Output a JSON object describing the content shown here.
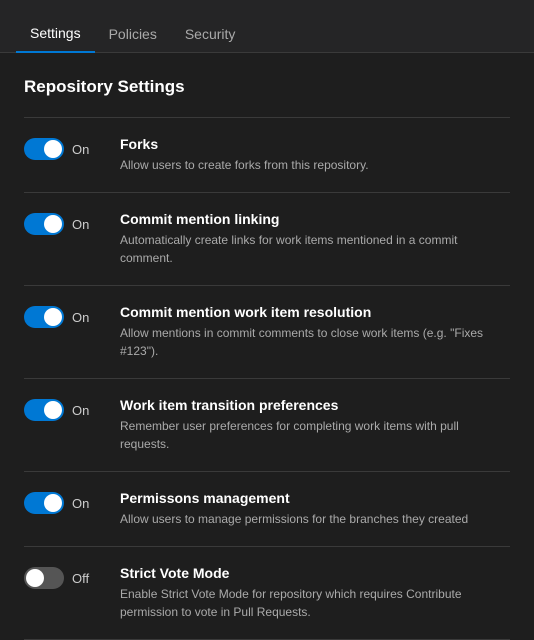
{
  "tabs": [
    {
      "id": "settings",
      "label": "Settings",
      "active": true
    },
    {
      "id": "policies",
      "label": "Policies",
      "active": false
    },
    {
      "id": "security",
      "label": "Security",
      "active": false
    }
  ],
  "section": {
    "title": "Repository Settings"
  },
  "settings": [
    {
      "id": "forks",
      "state": "on",
      "stateLabel": "On",
      "name": "Forks",
      "description": "Allow users to create forks from this repository."
    },
    {
      "id": "commit-mention-linking",
      "state": "on",
      "stateLabel": "On",
      "name": "Commit mention linking",
      "description": "Automatically create links for work items mentioned in a commit comment."
    },
    {
      "id": "commit-mention-work-item",
      "state": "on",
      "stateLabel": "On",
      "name": "Commit mention work item resolution",
      "description": "Allow mentions in commit comments to close work items (e.g. \"Fixes #123\")."
    },
    {
      "id": "work-item-transition",
      "state": "on",
      "stateLabel": "On",
      "name": "Work item transition preferences",
      "description": "Remember user preferences for completing work items with pull requests."
    },
    {
      "id": "permissions-management",
      "state": "on",
      "stateLabel": "On",
      "name": "Permissons management",
      "description": "Allow users to manage permissions for the branches they created"
    },
    {
      "id": "strict-vote-mode",
      "state": "off",
      "stateLabel": "Off",
      "name": "Strict Vote Mode",
      "description": "Enable Strict Vote Mode for repository which requires Contribute permission to vote in Pull Requests."
    }
  ]
}
